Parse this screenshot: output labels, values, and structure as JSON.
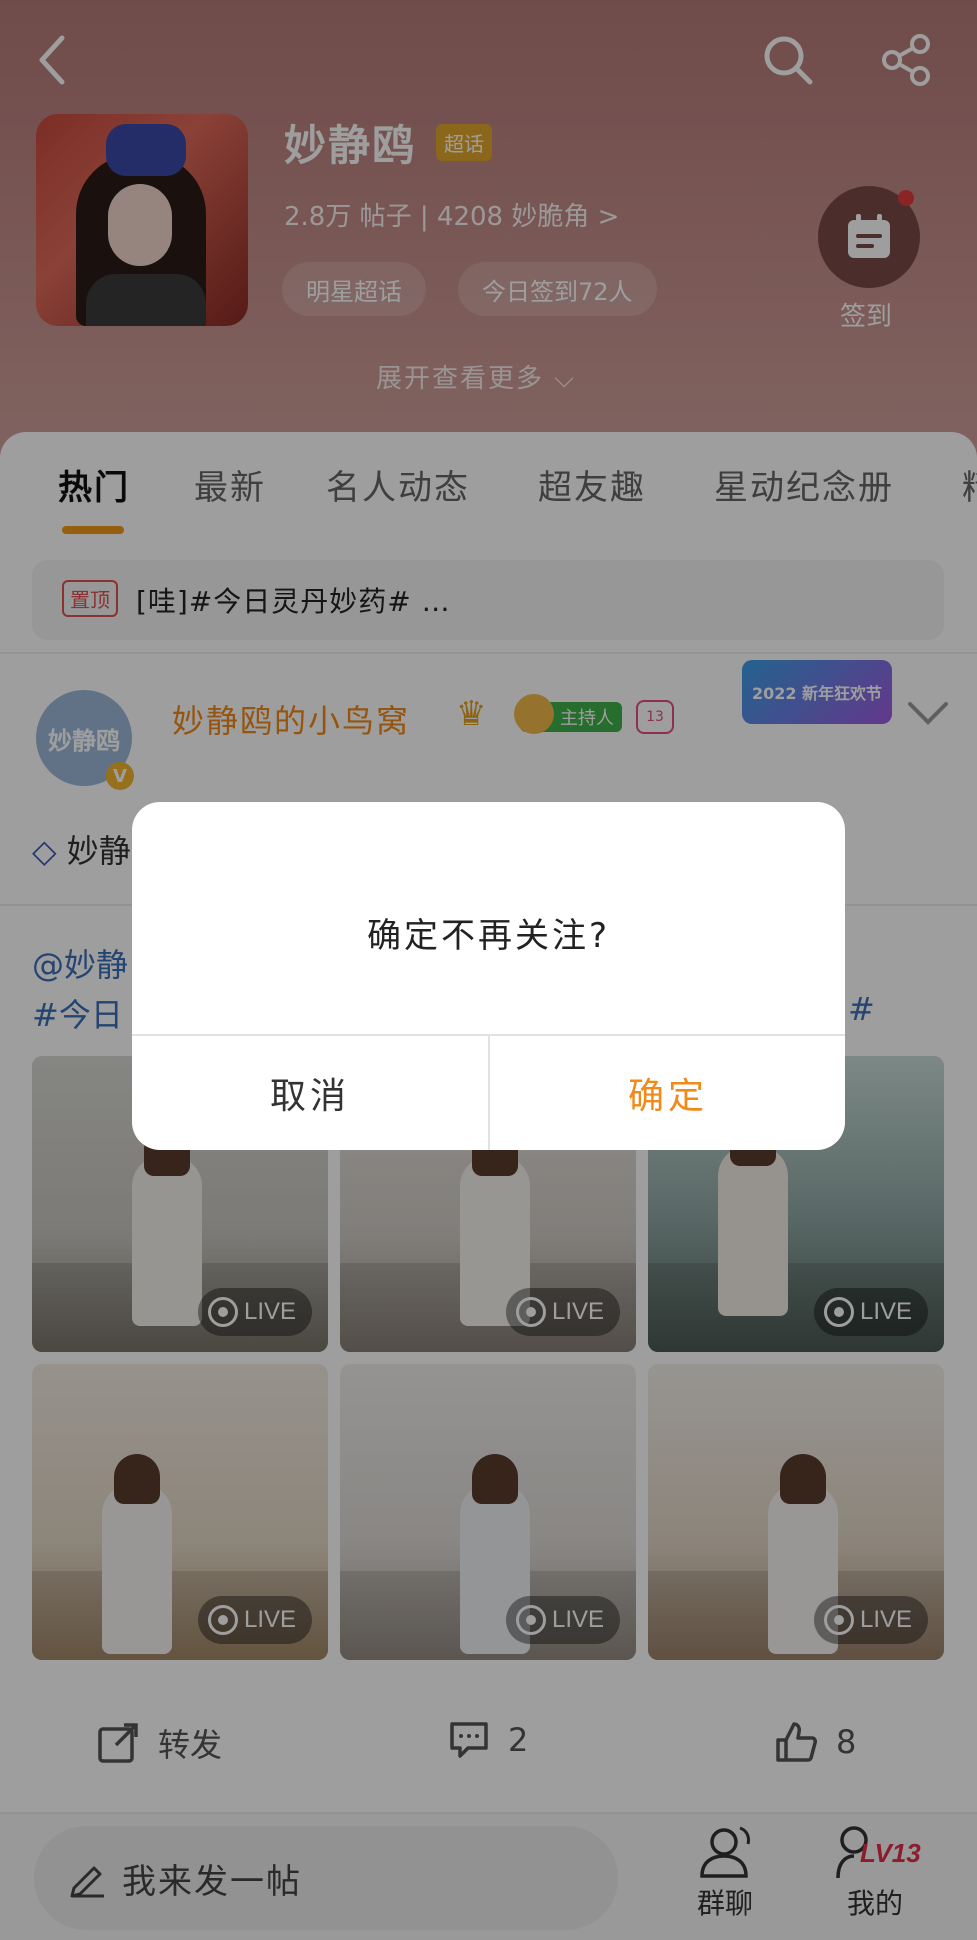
{
  "header": {
    "title": "妙静鸥",
    "super_badge": "超话",
    "stats": "2.8万 帖子 | 4208 妙脆角 >",
    "pills": [
      "明星超话",
      "今日签到72人"
    ],
    "checkin_label": "签到",
    "expand": "展开查看更多 ⌵"
  },
  "tabs": [
    "热门",
    "最新",
    "名人动态",
    "超友趣",
    "星动纪念册",
    "精"
  ],
  "pinned": {
    "tag": "置顶",
    "text": "[哇]#今日灵丹妙药# …"
  },
  "post": {
    "username": "妙静鸥的小鸟窝",
    "host_badge": "主持人",
    "level_badge": "13",
    "fest_badge": "2022 新年狂欢节",
    "avatar_text": "妙静鸥",
    "avatar_v": "V",
    "diamond_text": "妙静",
    "line1": "@妙静",
    "line2": "#今日",
    "hash_end": "#",
    "live_label": "LIVE"
  },
  "actions": {
    "repost": "转发",
    "comments": "2",
    "likes": "8"
  },
  "bottom": {
    "compose": "我来发一帖",
    "group_chat": "群聊",
    "mine": "我的",
    "lv": "LV13"
  },
  "dialog": {
    "message": "确定不再关注?",
    "cancel": "取消",
    "confirm": "确定"
  },
  "colors": {
    "accent": "#f08a1a",
    "link": "#3a6fb8",
    "confirm": "#f08a1a",
    "header": "#c58f8b"
  }
}
